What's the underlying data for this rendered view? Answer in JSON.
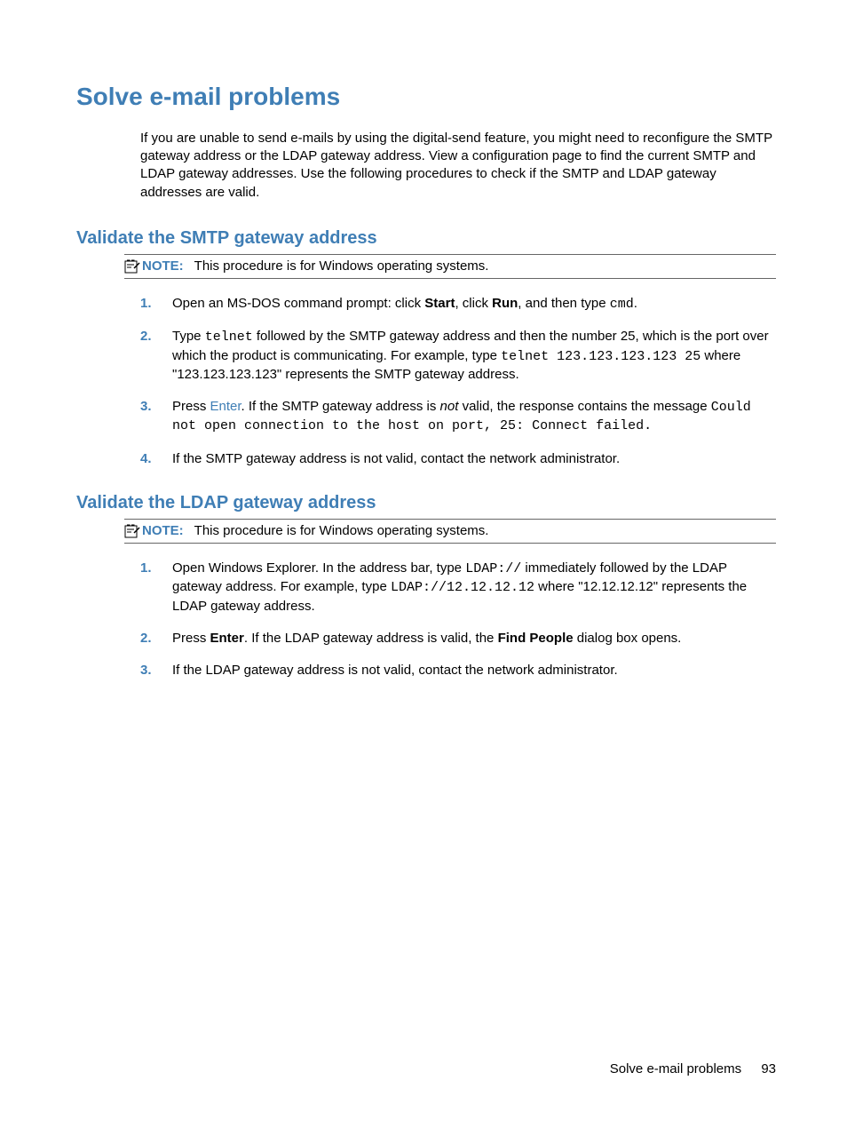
{
  "title": "Solve e-mail problems",
  "intro": "If you are unable to send e-mails by using the digital-send feature, you might need to reconfigure the SMTP gateway address or the LDAP gateway address. View a configuration page to find the current SMTP and LDAP gateway addresses. Use the following procedures to check if the SMTP and LDAP gateway addresses are valid.",
  "smtp": {
    "heading": "Validate the SMTP gateway address",
    "note_label": "NOTE:",
    "note_text": "This procedure is for Windows operating systems.",
    "steps": [
      {
        "num": "1.",
        "parts": [
          {
            "t": "text",
            "v": "Open an MS-DOS command prompt: click "
          },
          {
            "t": "bold",
            "v": "Start"
          },
          {
            "t": "text",
            "v": ", click "
          },
          {
            "t": "bold",
            "v": "Run"
          },
          {
            "t": "text",
            "v": ", and then type "
          },
          {
            "t": "mono",
            "v": "cmd"
          },
          {
            "t": "text",
            "v": "."
          }
        ]
      },
      {
        "num": "2.",
        "parts": [
          {
            "t": "text",
            "v": "Type "
          },
          {
            "t": "mono",
            "v": "telnet"
          },
          {
            "t": "text",
            "v": " followed by the SMTP gateway address and then the number 25, which is the port over which the product is communicating. For example, type "
          },
          {
            "t": "mono",
            "v": "telnet 123.123.123.123 25"
          },
          {
            "t": "text",
            "v": " where \"123.123.123.123\" represents the SMTP gateway address."
          }
        ]
      },
      {
        "num": "3.",
        "parts": [
          {
            "t": "text",
            "v": "Press "
          },
          {
            "t": "link",
            "v": "Enter"
          },
          {
            "t": "text",
            "v": ". If the SMTP gateway address is "
          },
          {
            "t": "italic",
            "v": "not"
          },
          {
            "t": "text",
            "v": " valid, the response contains the message "
          },
          {
            "t": "mono",
            "v": "Could not open connection to the host on port, 25: Connect failed."
          }
        ]
      },
      {
        "num": "4.",
        "parts": [
          {
            "t": "text",
            "v": "If the SMTP gateway address is not valid, contact the network administrator."
          }
        ]
      }
    ]
  },
  "ldap": {
    "heading": "Validate the LDAP gateway address",
    "note_label": "NOTE:",
    "note_text": "This procedure is for Windows operating systems.",
    "steps": [
      {
        "num": "1.",
        "parts": [
          {
            "t": "text",
            "v": "Open Windows Explorer. In the address bar, type "
          },
          {
            "t": "mono",
            "v": "LDAP://"
          },
          {
            "t": "text",
            "v": " immediately followed by the LDAP gateway address. For example, type "
          },
          {
            "t": "mono",
            "v": "LDAP://12.12.12.12"
          },
          {
            "t": "text",
            "v": " where \"12.12.12.12\" represents the LDAP gateway address."
          }
        ]
      },
      {
        "num": "2.",
        "parts": [
          {
            "t": "text",
            "v": "Press "
          },
          {
            "t": "bold",
            "v": "Enter"
          },
          {
            "t": "text",
            "v": ". If the LDAP gateway address is valid, the "
          },
          {
            "t": "bold",
            "v": "Find People"
          },
          {
            "t": "text",
            "v": " dialog box opens."
          }
        ]
      },
      {
        "num": "3.",
        "parts": [
          {
            "t": "text",
            "v": "If the LDAP gateway address is not valid, contact the network administrator."
          }
        ]
      }
    ]
  },
  "footer": {
    "section": "Solve e-mail problems",
    "page": "93"
  }
}
